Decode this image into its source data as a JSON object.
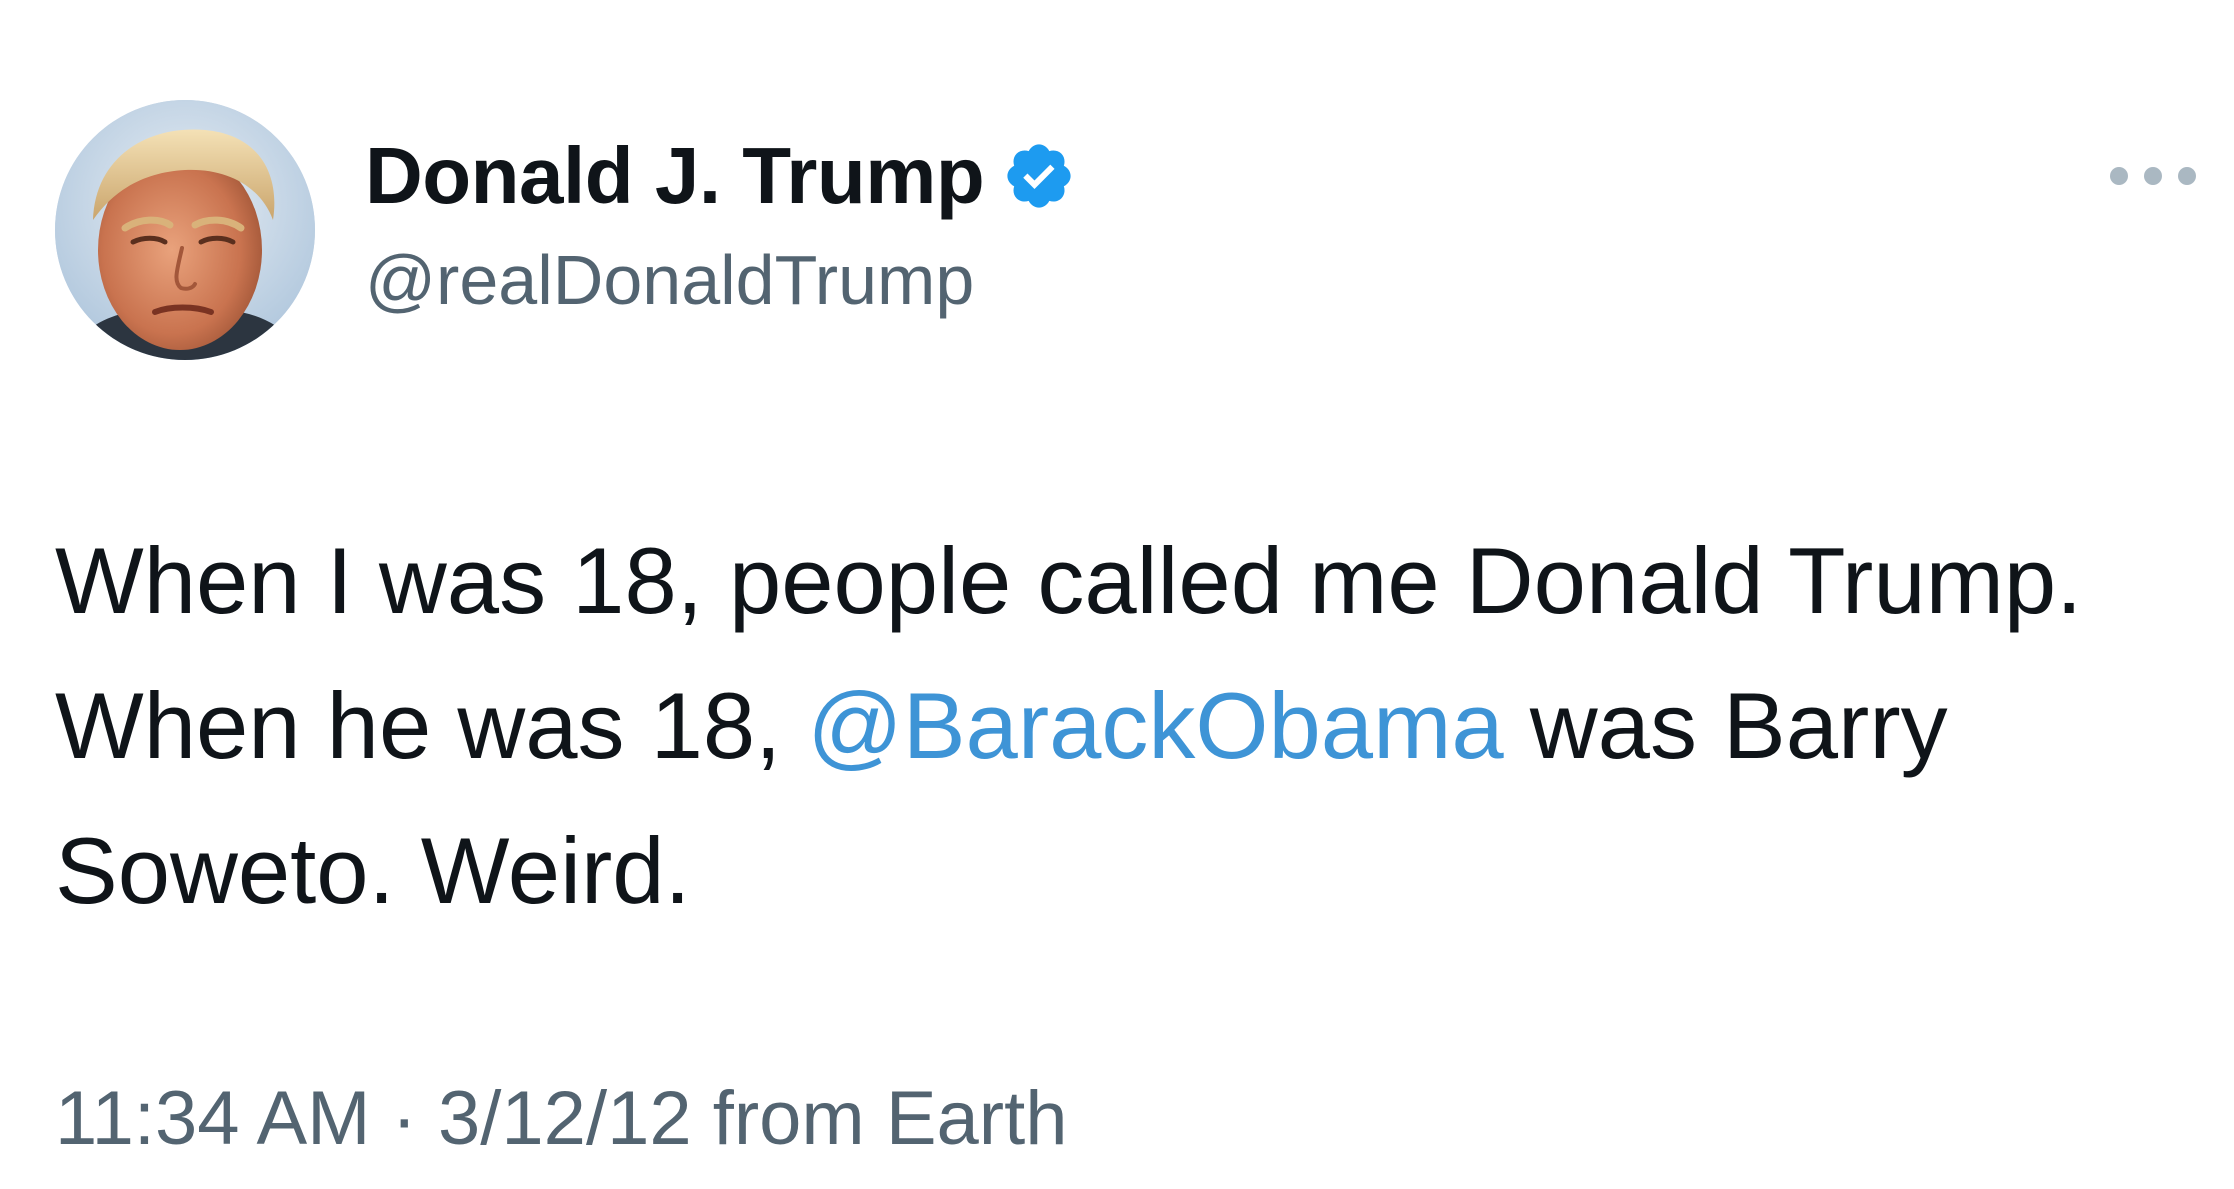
{
  "tweet": {
    "author": {
      "display_name": "Donald J. Trump",
      "handle": "@realDonaldTrump",
      "verified": true,
      "avatar_icon": "profile-photo"
    },
    "more_icon": "ellipsis-icon",
    "body": {
      "line1": "When I was 18, people called me Donald Trump.",
      "line2_prefix": "When he was 18,",
      "mention": "@BarackObama",
      "line2_suffix": "was Barry",
      "line3": "Soweto. Weird."
    },
    "meta": {
      "time": "11:34 AM",
      "separator": "·",
      "date": "3/12/12",
      "source": "from Earth"
    }
  },
  "colors": {
    "text": "#0f1419",
    "muted": "#536471",
    "link": "#3e94d6",
    "verified_badge": "#1d9bf0",
    "background": "#ffffff"
  }
}
